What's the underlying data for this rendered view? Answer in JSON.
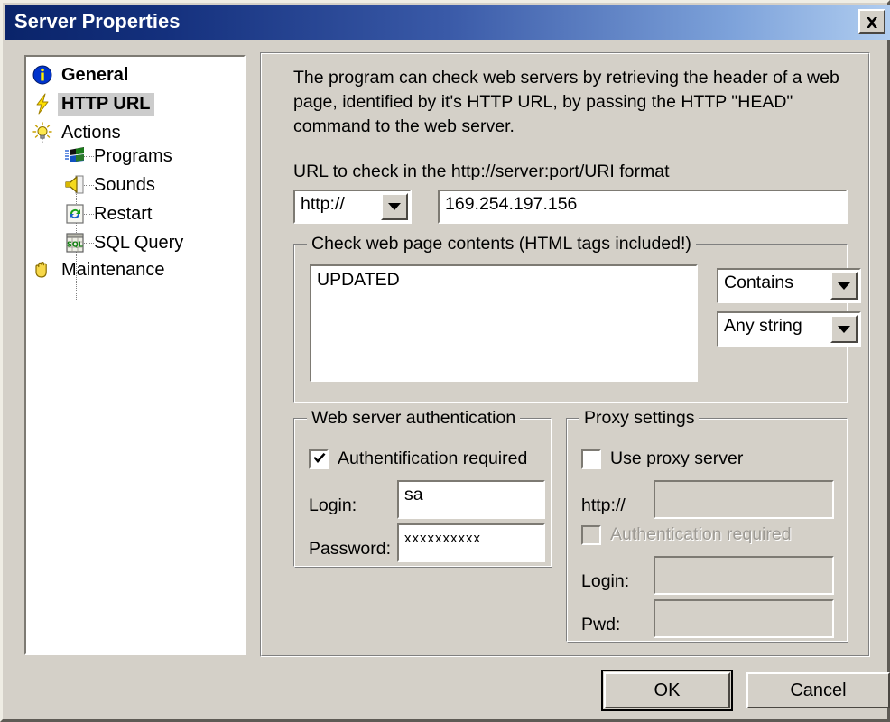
{
  "window": {
    "title": "Server Properties",
    "close_icon": "close-x-icon",
    "title_gradient_start": "#0A246A",
    "title_gradient_end": "#B0CDF0",
    "face_color": "#D4D0C8"
  },
  "tree": {
    "items": [
      {
        "label": "General",
        "icon": "info-icon",
        "indent": 0,
        "bold": true,
        "selected": false
      },
      {
        "label": "HTTP URL",
        "icon": "lightning-icon",
        "indent": 0,
        "bold": true,
        "selected": true
      },
      {
        "label": "Actions",
        "icon": "lightbulb-icon",
        "indent": 0,
        "bold": false,
        "selected": false
      },
      {
        "label": "Programs",
        "icon": "windows-flag-icon",
        "indent": 1,
        "bold": false,
        "selected": false
      },
      {
        "label": "Sounds",
        "icon": "speaker-icon",
        "indent": 1,
        "bold": false,
        "selected": false
      },
      {
        "label": "Restart",
        "icon": "restart-icon",
        "indent": 1,
        "bold": false,
        "selected": false
      },
      {
        "label": "SQL Query",
        "icon": "sql-icon",
        "indent": 1,
        "bold": false,
        "selected": false
      },
      {
        "label": "Maintenance",
        "icon": "hand-icon",
        "indent": 0,
        "bold": false,
        "selected": false
      }
    ]
  },
  "main": {
    "description": "The program can check web servers by retrieving the header of a web page, identified by it's HTTP URL, by passing the HTTP \"HEAD\" command to the web server.",
    "url_label": "URL to check in the http://server:port/URI format",
    "protocol_value": "http://",
    "url_value": "169.254.197.156",
    "contents_group": {
      "title": "Check web page contents (HTML tags included!)",
      "textarea_value": "UPDATED",
      "match_mode_value": "Contains",
      "match_scope_value": "Any string"
    },
    "web_auth_group": {
      "title": "Web server authentication",
      "auth_required_label": "Authentification required",
      "auth_required_checked": true,
      "login_label": "Login:",
      "login_value": "sa",
      "password_label": "Password:",
      "password_value": "xxxxxxxxxx"
    },
    "proxy_group": {
      "title": "Proxy settings",
      "use_proxy_label": "Use proxy server",
      "use_proxy_checked": false,
      "http_label": "http://",
      "http_value": "",
      "auth_required_label": "Authentication required",
      "auth_required_checked": false,
      "auth_required_disabled": true,
      "login_label": "Login:",
      "login_value": "",
      "pwd_label": "Pwd:",
      "pwd_value": ""
    }
  },
  "footer": {
    "ok_label": "OK",
    "cancel_label": "Cancel"
  }
}
